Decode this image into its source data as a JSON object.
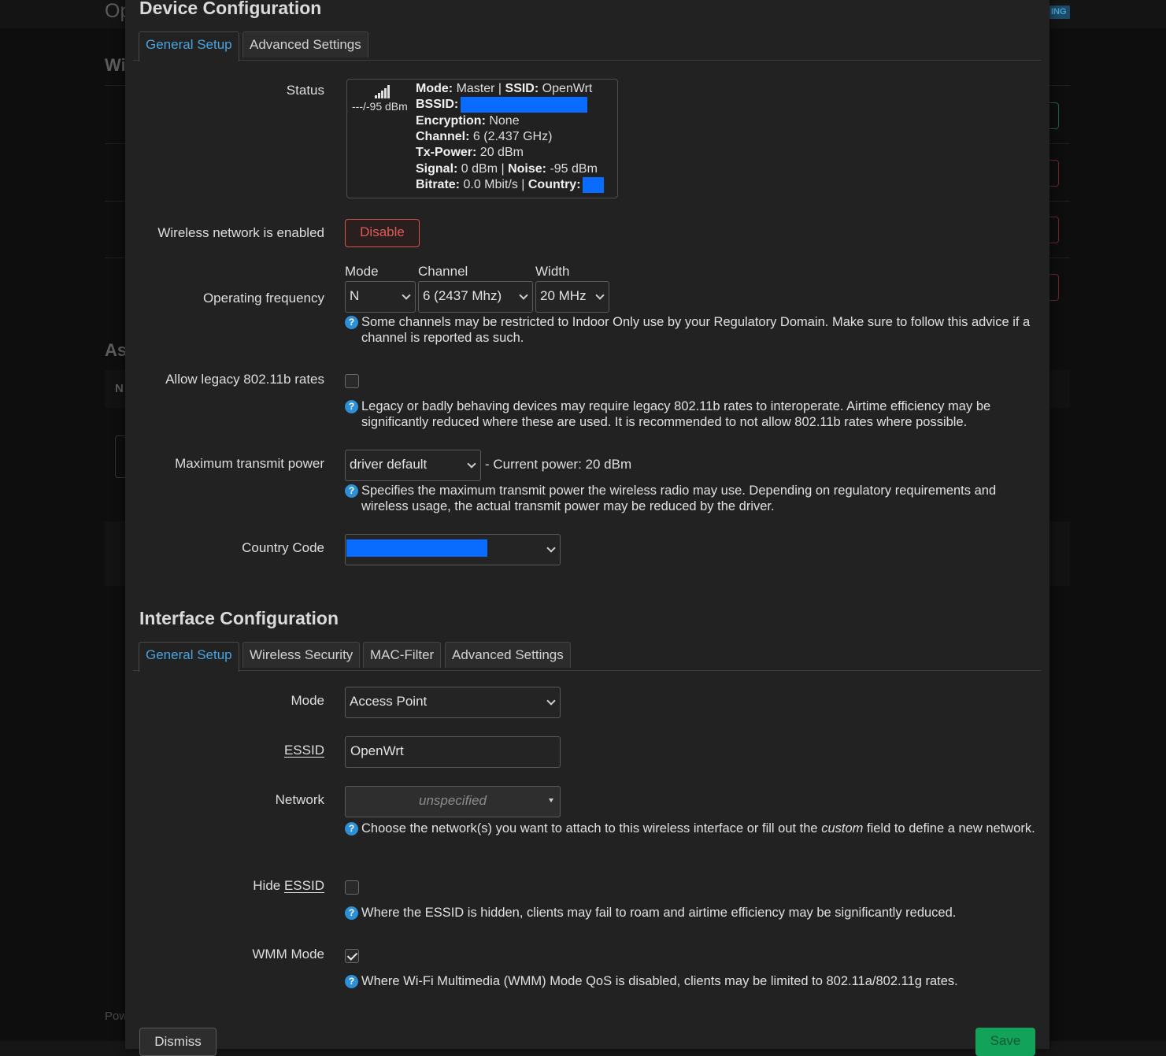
{
  "background": {
    "title": "Op",
    "section1": "Wi",
    "section2": "As",
    "table_header": "N",
    "badge": "ING",
    "footer": "Pow"
  },
  "device_config": {
    "title": "Device Configuration",
    "tabs": [
      {
        "label": "General Setup",
        "active": true
      },
      {
        "label": "Advanced Settings",
        "active": false
      }
    ],
    "status": {
      "label": "Status",
      "signal_text": "---/-95 dBm",
      "mode_key": "Mode:",
      "mode_val": "Master",
      "ssid_key": "SSID:",
      "ssid_val": "OpenWrt",
      "bssid_key": "BSSID:",
      "encryption_key": "Encryption:",
      "encryption_val": "None",
      "channel_key": "Channel:",
      "channel_val": "6 (2.437 GHz)",
      "txpower_key": "Tx-Power:",
      "txpower_val": "20 dBm",
      "signal_key": "Signal:",
      "signal_val": "0 dBm",
      "noise_key": "Noise:",
      "noise_val": "-95 dBm",
      "bitrate_key": "Bitrate:",
      "bitrate_val": "0.0 Mbit/s",
      "country_key": "Country:"
    },
    "enabled": {
      "label": "Wireless network is enabled",
      "button": "Disable"
    },
    "frequency": {
      "label": "Operating frequency",
      "mode_label": "Mode",
      "channel_label": "Channel",
      "width_label": "Width",
      "mode_value": "N",
      "channel_value": "6 (2437 Mhz)",
      "width_value": "20 MHz",
      "help": "Some channels may be restricted to Indoor Only use by your Regulatory Domain. Make sure to follow this advice if a channel is reported as such."
    },
    "legacy": {
      "label": "Allow legacy 802.11b rates",
      "checked": false,
      "help": "Legacy or badly behaving devices may require legacy 802.11b rates to interoperate. Airtime efficiency may be significantly reduced where these are used. It is recommended to not allow 802.11b rates where possible."
    },
    "txpower": {
      "label": "Maximum transmit power",
      "value": "driver default",
      "current": "- Current power: 20 dBm",
      "help": "Specifies the maximum transmit power the wireless radio may use. Depending on regulatory requirements and wireless usage, the actual transmit power may be reduced by the driver."
    },
    "country": {
      "label": "Country Code"
    }
  },
  "interface_config": {
    "title": "Interface Configuration",
    "tabs": [
      {
        "label": "General Setup",
        "active": true
      },
      {
        "label": "Wireless Security",
        "active": false
      },
      {
        "label": "MAC-Filter",
        "active": false
      },
      {
        "label": "Advanced Settings",
        "active": false
      }
    ],
    "mode": {
      "label": "Mode",
      "value": "Access Point"
    },
    "essid": {
      "label": "ESSID",
      "value": "OpenWrt"
    },
    "network": {
      "label": "Network",
      "value": "unspecified",
      "help_pre": "Choose the network(s) you want to attach to this wireless interface or fill out the",
      "help_em": "custom",
      "help_post": "field to define a new network."
    },
    "hide_essid": {
      "label_pre": "Hide",
      "label_u": "ESSID",
      "checked": false,
      "help": "Where the ESSID is hidden, clients may fail to roam and airtime efficiency may be significantly reduced."
    },
    "wmm": {
      "label": "WMM Mode",
      "checked": true,
      "help": "Where Wi-Fi Multimedia (WMM) Mode QoS is disabled, clients may be limited to 802.11a/802.11g rates."
    }
  },
  "footer": {
    "dismiss": "Dismiss",
    "save": "Save"
  },
  "colors": {
    "accent": "#49a3de",
    "danger": "#d9534f",
    "save": "#12a25a",
    "redacted": "#0a6cff"
  }
}
